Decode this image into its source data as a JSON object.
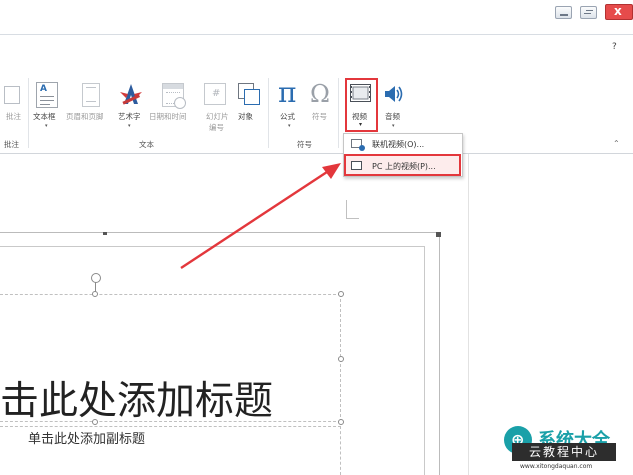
{
  "window": {
    "help_label": "?"
  },
  "ribbon": {
    "partial_left_label": "批注",
    "partial_group_label": "批注",
    "text_group": {
      "label": "文本",
      "textbox": "文本框",
      "header_footer": "页眉和页脚",
      "wordart": "艺术字",
      "datetime": "日期和时间",
      "slide_number_line1": "幻灯片",
      "slide_number_line2": "编号",
      "object": "对象"
    },
    "symbols_group": {
      "label": "符号",
      "formula": "公式",
      "symbol": "符号",
      "pi_glyph": "π",
      "omega_glyph": "Ω"
    },
    "media_group": {
      "video": "视频",
      "audio": "音频"
    }
  },
  "video_menu": {
    "items": [
      {
        "label": "联机视频(O)..."
      },
      {
        "label": "PC 上的视频(P)..."
      }
    ]
  },
  "slide": {
    "title_placeholder": "击此处添加标题",
    "subtitle_placeholder": "单击此处添加副标题"
  },
  "watermark": {
    "line1": "系统大全",
    "line2": "云教程中心",
    "line3": "www.xitongdaquan.com"
  },
  "colors": {
    "highlight": "#e3373c",
    "accent": "#2b6cb0",
    "watermark": "#1aa0a8"
  }
}
